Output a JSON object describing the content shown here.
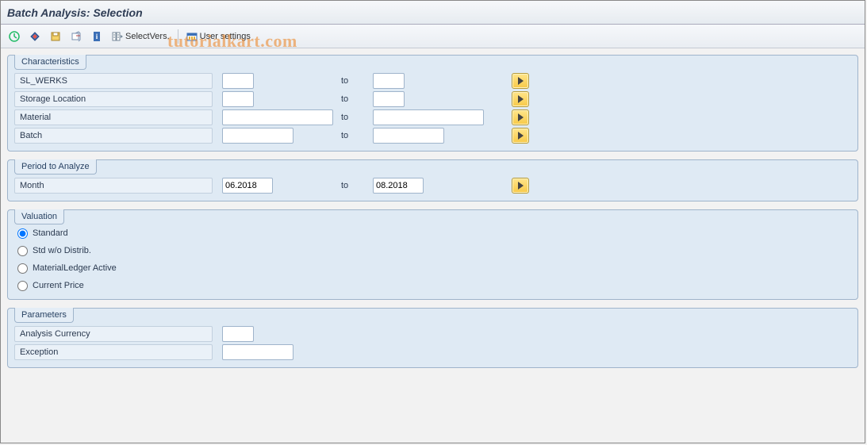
{
  "title": "Batch Analysis: Selection",
  "watermark": "tutorialkart.com",
  "toolbar": {
    "selectvers": "SelectVers.",
    "usersettings": "User settings"
  },
  "groups": {
    "characteristics": {
      "title": "Characteristics",
      "rows": {
        "sl_werks": {
          "label": "SL_WERKS",
          "from": "",
          "to_lbl": "to",
          "to": ""
        },
        "stloc": {
          "label": "Storage Location",
          "from": "",
          "to_lbl": "to",
          "to": ""
        },
        "material": {
          "label": "Material",
          "from": "",
          "to_lbl": "to",
          "to": ""
        },
        "batch": {
          "label": "Batch",
          "from": "",
          "to_lbl": "to",
          "to": ""
        }
      }
    },
    "period": {
      "title": "Period to Analyze",
      "month_lbl": "Month",
      "month_from": "06.2018",
      "to_lbl": "to",
      "month_to": "08.2018"
    },
    "valuation": {
      "title": "Valuation",
      "options": {
        "standard": "Standard",
        "stdwo": "Std w/o Distrib.",
        "ml": "MaterialLedger Active",
        "cp": "Current Price"
      },
      "selected": "standard"
    },
    "parameters": {
      "title": "Parameters",
      "currency_lbl": "Analysis Currency",
      "currency": "",
      "exception_lbl": "Exception",
      "exception": ""
    }
  }
}
